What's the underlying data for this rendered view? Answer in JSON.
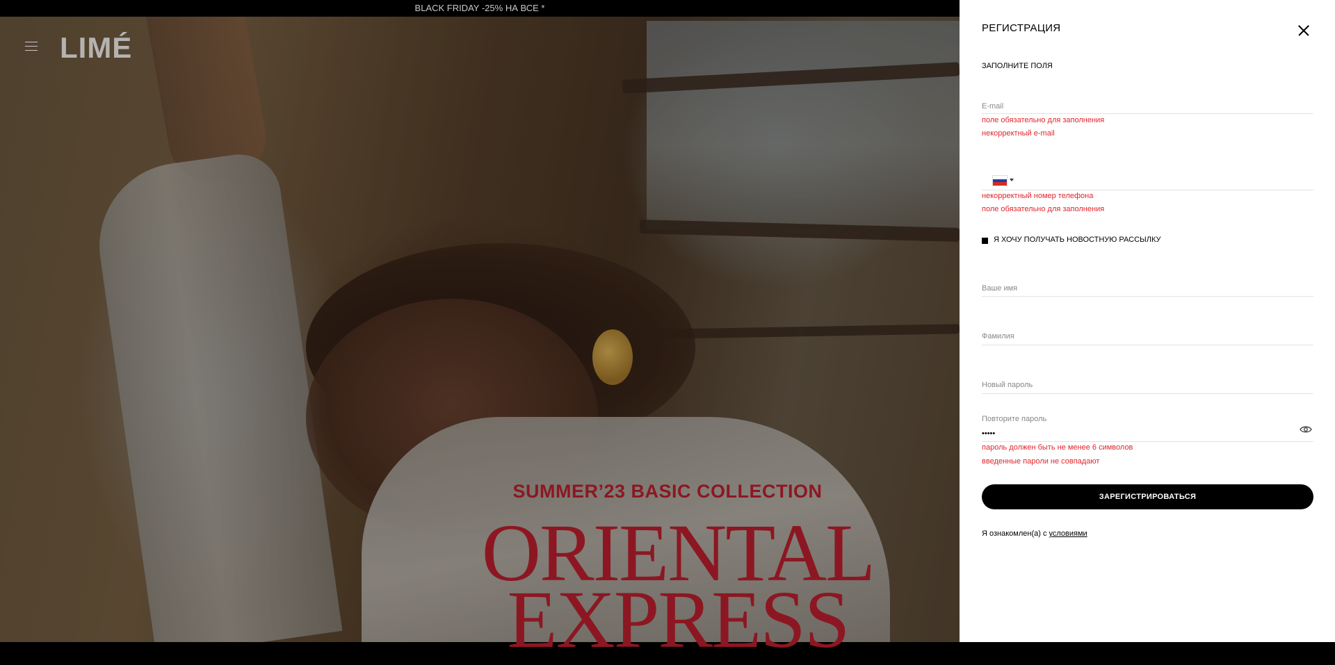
{
  "promo": {
    "text": "BLACK FRIDAY -25% НА ВСЕ *"
  },
  "header": {
    "logo": "LIMÉ",
    "menu_icon": "hamburger-menu-icon"
  },
  "campaign": {
    "subtitle": "SUMMER’23 BASIC COLLECTION",
    "title_line1": "ORIENTAL",
    "title_line2": "EXPRESS"
  },
  "registration": {
    "title": "РЕГИСТРАЦИЯ",
    "subtitle": "ЗАПОЛНИТЕ ПОЛЯ",
    "email": {
      "placeholder": "E-mail",
      "value": "",
      "errors": [
        "поле обязательно для заполнения",
        "некорректный e-mail"
      ]
    },
    "phone": {
      "country": "RU",
      "value": "",
      "errors": [
        "некорректный номер телефона",
        "поле обязательно для заполнения"
      ]
    },
    "newsletter": {
      "label": "Я ХОЧУ ПОЛУЧАТЬ НОВОСТНУЮ РАССЫЛКУ",
      "checked": true
    },
    "first_name": {
      "placeholder": "Ваше имя",
      "value": ""
    },
    "last_name": {
      "placeholder": "Фамилия",
      "value": ""
    },
    "new_password": {
      "placeholder": "Новый пароль",
      "value": ""
    },
    "repeat_password": {
      "label": "Повторите пароль",
      "value": "•••••",
      "errors": [
        "пароль должен быть не менее 6 символов",
        "введенные пароли не совпадают"
      ]
    },
    "submit_label": "ЗАРЕГИСТРИРОВАТЬСЯ",
    "terms_text": "Я ознакомлен(а) с ",
    "terms_link": "условиями"
  },
  "colors": {
    "error": "#e3242b",
    "accent": "#8c1722",
    "button": "#000000"
  }
}
